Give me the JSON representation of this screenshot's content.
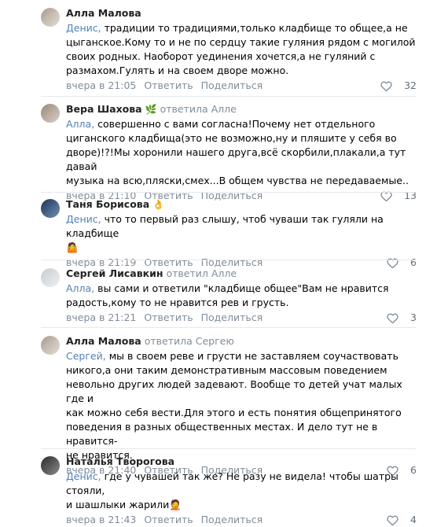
{
  "comments": [
    {
      "author": "Алла Малова",
      "replied": "",
      "emoji": "",
      "avatar_colors": [
        "#a89c8f",
        "#e6ded4"
      ],
      "addressee": "Денис,",
      "text_lines": [
        "традиции то традициями,только кладбище то общее,а не",
        "цыганское.Кому то и не по сердцу такие гуляния рядом с могилой",
        "своих родных. Наоборот уединения хочется,а не гуляний с",
        "размахом.Гулять и на своем дворе можно."
      ],
      "time": "вчера в 21:05",
      "reply": "Ответить",
      "share": "Поделиться",
      "likes": "32"
    },
    {
      "author": "Вера Шахова",
      "replied": "ответила Алле",
      "emoji": "🌿",
      "avatar_colors": [
        "#9b8878",
        "#d8cfc7"
      ],
      "addressee": "Алла,",
      "text_lines": [
        "совершенно с вами согласна!Почему нет отдельного",
        "циганского кладбища(это не возможно,ну и пляшите у себя во",
        "дворе)!?!Мы хоронили нашего друга,всё скорбили,плакали,а тут давай",
        "музыка на всю,пляски,смех...В общем чувства не передаваемые.."
      ],
      "time": "вчера в 21:10",
      "reply": "Ответить",
      "share": "Поделиться",
      "likes": "13"
    },
    {
      "author": "Таня Борисова",
      "replied": "",
      "emoji": "👌",
      "avatar_colors": [
        "#1f3556",
        "#6f8fb5"
      ],
      "addressee": "Денис,",
      "text_lines": [
        "что то первый раз слышу, чтоб чуваши так гуляли на кладбище",
        "🤷"
      ],
      "time": "вчера в 21:19",
      "reply": "Ответить",
      "share": "Поделиться",
      "likes": "6"
    },
    {
      "author": "Сергей Лисавкин",
      "replied": "ответил Алле",
      "emoji": "",
      "avatar_colors": [
        "#c8ccd2",
        "#eef0f2"
      ],
      "addressee": "Алла,",
      "text_lines": [
        "вы сами и ответили \"кладбище общее\"Вам не нравится",
        "радость,кому то не нравится рев и грусть."
      ],
      "time": "вчера в 21:21",
      "reply": "Ответить",
      "share": "Поделиться",
      "likes": "3"
    },
    {
      "author": "Алла Малова",
      "replied": "ответила Сергею",
      "emoji": "",
      "avatar_colors": [
        "#a89c8f",
        "#e6ded4"
      ],
      "addressee": "Сергей,",
      "text_lines": [
        "мы в своем реве и грусти не заставляем соучаствовать",
        "никого,а они таким демонстративным массовым поведением",
        "невольно других людей задевают. Вообще то детей учат малых где и",
        "как можно себя вести.Для этого и есть понятия общепринятого",
        "поведения в разных общественных местах. И дело тут не в нравится-",
        "не нравится."
      ],
      "time": "вчера в 21:40",
      "reply": "Ответить",
      "share": "Поделиться",
      "likes": "6"
    },
    {
      "author": "Наталья Творогова",
      "replied": "",
      "emoji": "",
      "avatar_colors": [
        "#2b2b2b",
        "#8a8a8a"
      ],
      "addressee": "Денис,",
      "text_lines": [
        "где у чувашей так же? Не разу не видела! чтобы шатры стояли,",
        "и шашлыки жарили🤦"
      ],
      "time": "вчера в 21:43",
      "reply": "Ответить",
      "share": "Поделиться",
      "likes": "4"
    }
  ]
}
